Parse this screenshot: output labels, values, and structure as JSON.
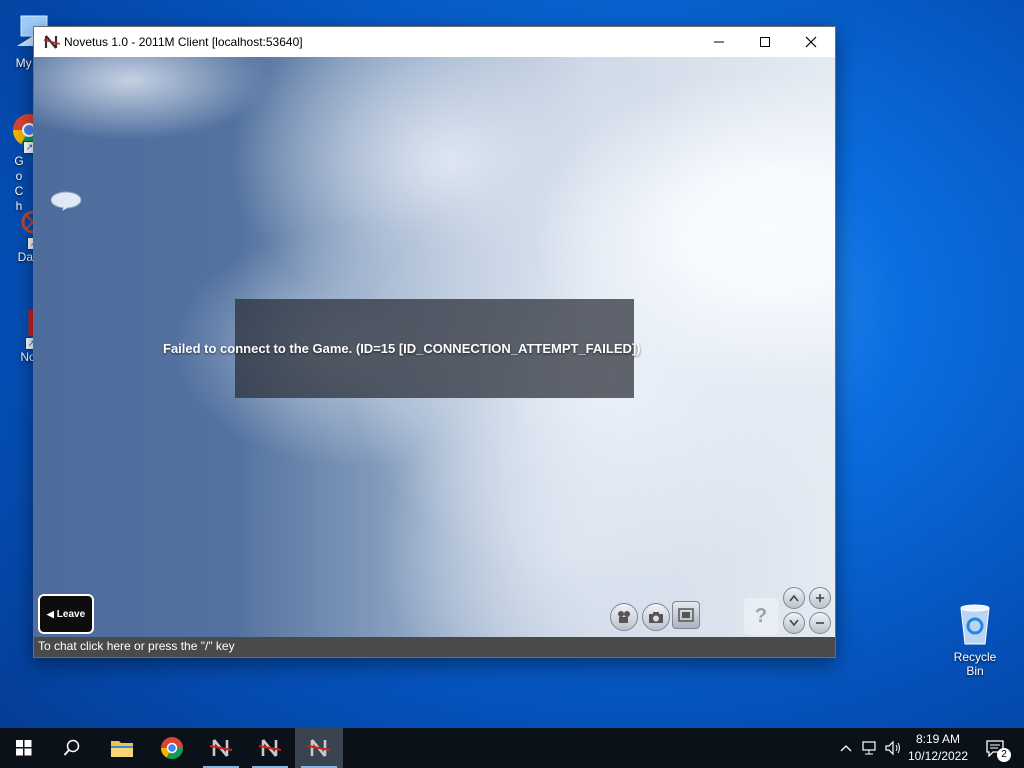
{
  "desktop": {
    "icons": [
      {
        "label": "My Co"
      },
      {
        "label": "Go Ch"
      },
      {
        "label": "DataW"
      },
      {
        "label": "Novet"
      }
    ],
    "recycle_bin": {
      "label": "Recycle Bin"
    }
  },
  "window": {
    "title": "Novetus 1.0 - 2011M Client [localhost:53640]",
    "error_message": "Failed to connect to the Game. (ID=15 [ID_CONNECTION_ATTEMPT_FAILED])",
    "leave_label": "Leave",
    "help_label": "?",
    "chat_hint": "To chat click here or press the \"/\" key"
  },
  "taskbar": {
    "clock_time": "8:19 AM",
    "clock_date": "10/12/2022",
    "notification_count": "2"
  },
  "colors": {
    "desktop_blue": "#0a6ee0",
    "taskbar_bg": "#0b1118",
    "novetus_red": "#d11f1f",
    "chrome_green": "#1a9e41",
    "chrome_yellow": "#f8c81c",
    "chrome_blue": "#4285f4"
  }
}
